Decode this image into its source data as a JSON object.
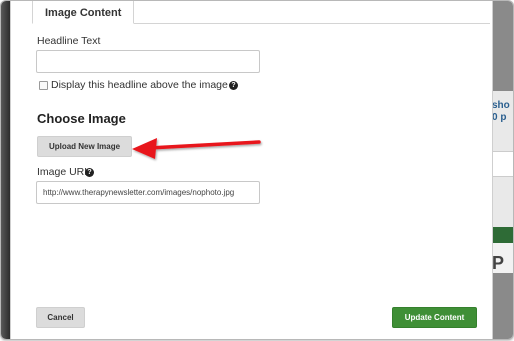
{
  "tab": {
    "label": "Image Content"
  },
  "headline": {
    "label": "Headline Text",
    "value": "",
    "display_checkbox_label": "Display this headline above the image",
    "help_glyph": "?"
  },
  "choose_image": {
    "heading": "Choose Image",
    "upload_button": "Upload New Image"
  },
  "image_url": {
    "label": "Image URL",
    "help_glyph": "?",
    "value": "http://www.therapynewsletter.com/images/nophoto.jpg"
  },
  "footer": {
    "cancel_label": "Cancel",
    "update_label": "Update Content"
  },
  "background_fragments": {
    "frag1": "sho",
    "frag2": "0 p",
    "frag3": "P"
  },
  "colors": {
    "accent_green": "#3f8f36",
    "annotation_arrow": "#e8141b"
  },
  "icons": [
    "help-icon",
    "annotation-arrow-icon"
  ]
}
